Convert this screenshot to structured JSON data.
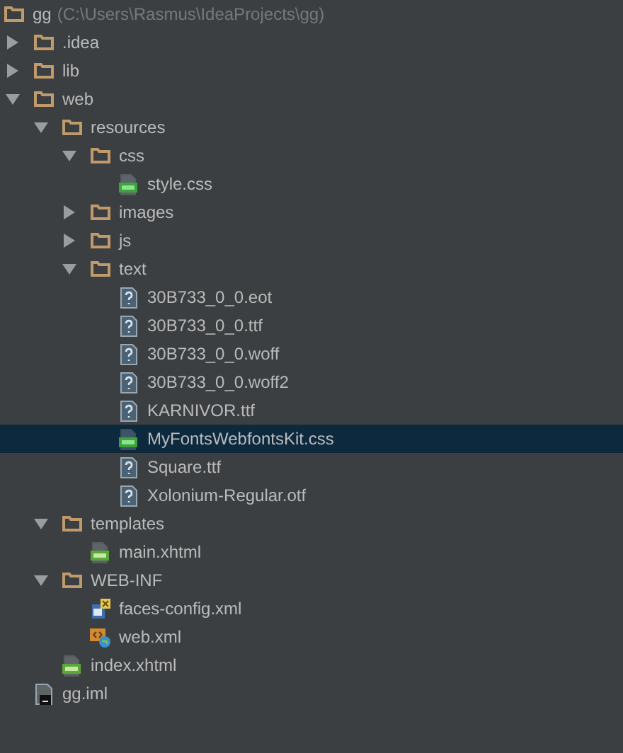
{
  "project": {
    "name": "gg",
    "path": "(C:\\Users\\Rasmus\\IdeaProjects\\gg)"
  },
  "tree": [
    {
      "label": ".idea",
      "kind": "folder",
      "expanded": false,
      "selected": false
    },
    {
      "label": "lib",
      "kind": "folder",
      "expanded": false,
      "selected": false
    },
    {
      "label": "web",
      "kind": "folder",
      "expanded": true,
      "selected": false,
      "children": [
        {
          "label": "resources",
          "kind": "folder",
          "expanded": true,
          "selected": false,
          "children": [
            {
              "label": "css",
              "kind": "folder",
              "expanded": true,
              "selected": false,
              "children": [
                {
                  "label": "style.css",
                  "kind": "css",
                  "selected": false
                }
              ]
            },
            {
              "label": "images",
              "kind": "folder",
              "expanded": false,
              "selected": false
            },
            {
              "label": "js",
              "kind": "folder",
              "expanded": false,
              "selected": false
            },
            {
              "label": "text",
              "kind": "folder",
              "expanded": true,
              "selected": false,
              "children": [
                {
                  "label": "30B733_0_0.eot",
                  "kind": "unknown",
                  "selected": false
                },
                {
                  "label": "30B733_0_0.ttf",
                  "kind": "unknown",
                  "selected": false
                },
                {
                  "label": "30B733_0_0.woff",
                  "kind": "unknown",
                  "selected": false
                },
                {
                  "label": "30B733_0_0.woff2",
                  "kind": "unknown",
                  "selected": false
                },
                {
                  "label": "KARNIVOR.ttf",
                  "kind": "unknown",
                  "selected": false
                },
                {
                  "label": "MyFontsWebfontsKit.css",
                  "kind": "css",
                  "selected": true
                },
                {
                  "label": "Square.ttf",
                  "kind": "unknown",
                  "selected": false
                },
                {
                  "label": "Xolonium-Regular.otf",
                  "kind": "unknown",
                  "selected": false
                }
              ]
            }
          ]
        },
        {
          "label": "templates",
          "kind": "folder",
          "expanded": true,
          "selected": false,
          "children": [
            {
              "label": "main.xhtml",
              "kind": "jsf",
              "selected": false
            }
          ]
        },
        {
          "label": "WEB-INF",
          "kind": "folder",
          "expanded": true,
          "selected": false,
          "children": [
            {
              "label": "faces-config.xml",
              "kind": "faces",
              "selected": false
            },
            {
              "label": "web.xml",
              "kind": "webxml",
              "selected": false
            }
          ]
        },
        {
          "label": "index.xhtml",
          "kind": "jsf",
          "selected": false
        }
      ]
    },
    {
      "label": "gg.iml",
      "kind": "iml",
      "selected": false
    }
  ]
}
